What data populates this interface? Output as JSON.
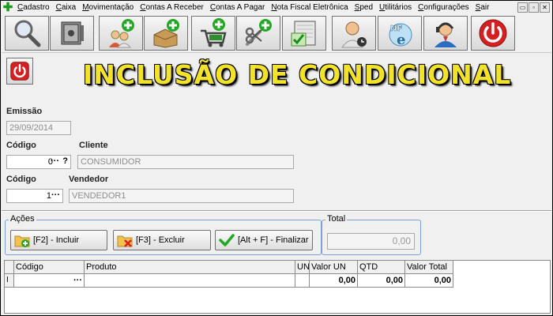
{
  "menubar": {
    "items": [
      "Cadastro",
      "Caixa",
      "Movimentação",
      "Contas A Receber",
      "Contas A Pagar",
      "Nota Fiscal Eletrônica",
      "Sped",
      "Utilitários",
      "Configurações",
      "Sair"
    ],
    "window_controls": [
      "▭",
      "▫",
      "✕"
    ]
  },
  "toolbar": {
    "buttons": [
      "search-icon",
      "safe-icon",
      "add-client-icon",
      "add-product-icon",
      "add-cart-icon",
      "add-tools-icon",
      "checklist-icon",
      "user-clock-icon",
      "nfe-icon",
      "support-agent-icon",
      "power-icon"
    ]
  },
  "title": "INCLUSÃO DE CONDICIONAL",
  "form": {
    "emissao_label": "Emissão",
    "emissao_value": "29/09/2014",
    "cliente_codigo_label": "Código",
    "cliente_codigo_value": "0",
    "cliente_label": "Cliente",
    "cliente_value": "CONSUMIDOR",
    "vendedor_codigo_label": "Código",
    "vendedor_codigo_value": "1",
    "vendedor_label": "Vendedor",
    "vendedor_value": "VENDEDOR1",
    "ellipsis": "···",
    "question": "?"
  },
  "acoes": {
    "title": "Ações",
    "incluir": "[F2] - Incluir",
    "excluir": "[F3] - Excluir",
    "finalizar": "[Alt + F] - Finalizar"
  },
  "total": {
    "title": "Total",
    "value": "0,00"
  },
  "grid": {
    "columns": [
      "Código",
      "Produto",
      "UN",
      "Valor UN",
      "QTD",
      "Valor Total"
    ],
    "row": {
      "indicator": "I",
      "codigo": "",
      "ellipsis": "···",
      "produto": "",
      "un": "",
      "valor_un": "0,00",
      "qtd": "0,00",
      "valor_total": "0,00"
    }
  },
  "colors": {
    "title_yellow": "#f2e22a",
    "group_border": "#7aa0d6",
    "power_red": "#d42020",
    "add_green": "#23a824"
  }
}
